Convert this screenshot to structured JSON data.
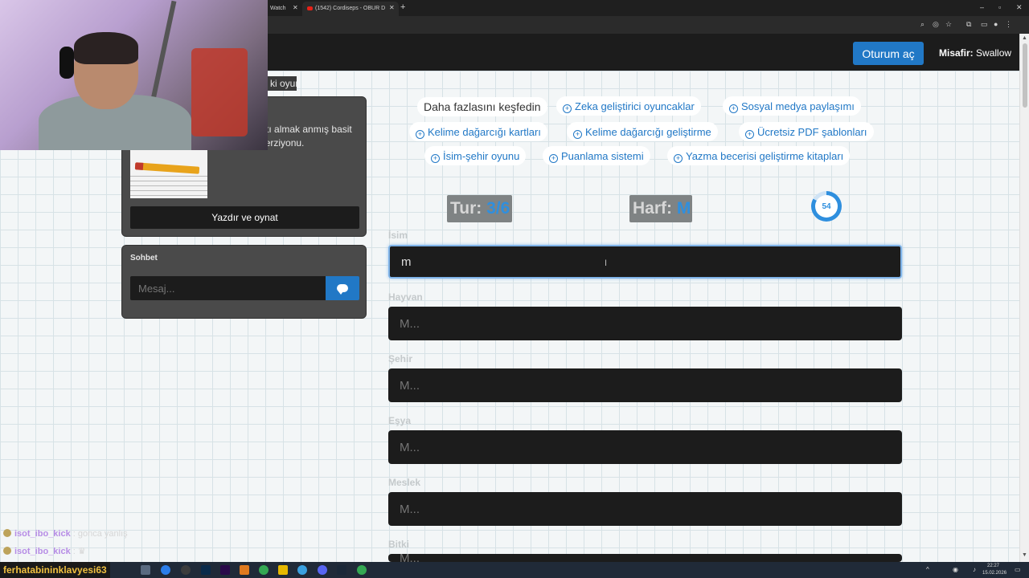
{
  "browser": {
    "tab1_title": "Watch",
    "tab2_title": "(1542) Cordiseps - OBUR D",
    "new_tab": "+"
  },
  "header": {
    "login_label": "Oturum aç",
    "guest_label": "Misafir:",
    "guest_name": "Swallow"
  },
  "overlay_tag": "ki oyun",
  "print_card": {
    "text": "azıcıdan çıktı almak anmış basit PDF oyun verziyonu.",
    "button_label": "Yazdır ve oynat"
  },
  "chat_card": {
    "title": "Sohbet",
    "placeholder": "Mesaj..."
  },
  "discover": {
    "heading": "Daha fazlasını keşfedin",
    "links": [
      "Zeka geliştirici oyuncaklar",
      "Sosyal medya paylaşımı",
      "Kelime dağarcığı kartları",
      "Kelime dağarcığı geliştirme",
      "Ücretsiz PDF şablonları",
      "İsim-şehir oyunu",
      "Puanlama sistemi",
      "Yazma becerisi geliştirme kitapları"
    ]
  },
  "game": {
    "round_label": "Tur:",
    "round_value": "3/6",
    "letter_label": "Harf:",
    "letter_value": "M",
    "timer": "54"
  },
  "fields": [
    {
      "label": "İsim",
      "value": "m",
      "placeholder": "M..."
    },
    {
      "label": "Hayvan",
      "value": "",
      "placeholder": "M..."
    },
    {
      "label": "Şehir",
      "value": "",
      "placeholder": "M..."
    },
    {
      "label": "Eşya",
      "value": "",
      "placeholder": "M..."
    },
    {
      "label": "Meslek",
      "value": "",
      "placeholder": "M..."
    },
    {
      "label": "Bitki",
      "value": "",
      "placeholder": "M..."
    }
  ],
  "kick_chat": [
    {
      "user": "isot_ibo_kick",
      "message": ": gonca yanlış"
    },
    {
      "user": "isot_ibo_kick",
      "message": ":"
    }
  ],
  "kick_highlight": "ferhatabininklavyesi63",
  "taskbar": {
    "time": "22:27",
    "date": "15.02.2026"
  }
}
